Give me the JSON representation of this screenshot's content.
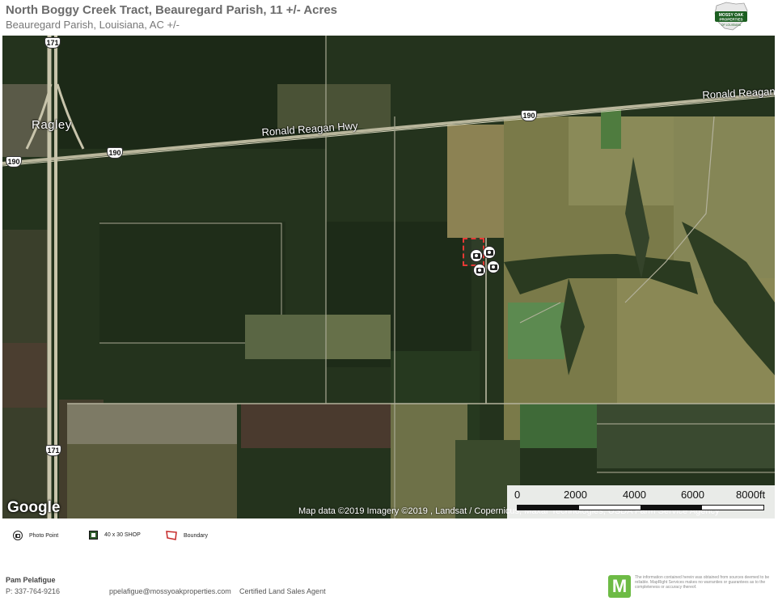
{
  "header": {
    "title": "North Boggy Creek Tract, Beauregard Parish, 11 +/- Acres",
    "subtitle": "Beauregard Parish, Louisiana,  AC +/-",
    "logo_text": "MOSSY OAK PROPERTIES OF LOUISIANA"
  },
  "map": {
    "town_label": "Ragley",
    "road_labels": [
      "Ronald Reagan Hwy",
      "Ronald Reagan"
    ],
    "shields": [
      {
        "text": "171"
      },
      {
        "text": "190"
      },
      {
        "text": "190"
      },
      {
        "text": "190"
      },
      {
        "text": "171"
      }
    ],
    "google_logo": "Google",
    "attribution": "Map data ©2019  Imagery ©2019 , Landsat / Copernicus, Maxar Technologies, USDA Farm Service Agency",
    "scale": {
      "labels": [
        "0",
        "2000",
        "4000",
        "6000",
        "8000ft"
      ]
    },
    "photo_point_count": 4,
    "colors": {
      "boundary": "#e53935",
      "forest": "#22321c",
      "field": "#8f8b55"
    }
  },
  "legend": {
    "items": [
      {
        "label": "Photo Point",
        "icon": "camera-icon"
      },
      {
        "label": "40 x 30 SHOP",
        "icon": "shop-icon"
      },
      {
        "label": "Boundary",
        "icon": "boundary-icon"
      }
    ]
  },
  "footer": {
    "agent_name": "Pam Pelafigue",
    "agent_phone": "P: 337-764-9216",
    "agent_email": "ppelafigue@mossyoakproperties.com",
    "agent_role": "Certified Land Sales Agent",
    "mappright_logo": "M",
    "disclaimer": "The information contained herein was obtained from sources deemed to be reliable. MapRight Services makes no warranties or guarantees as to the completeness or accuracy thereof."
  }
}
